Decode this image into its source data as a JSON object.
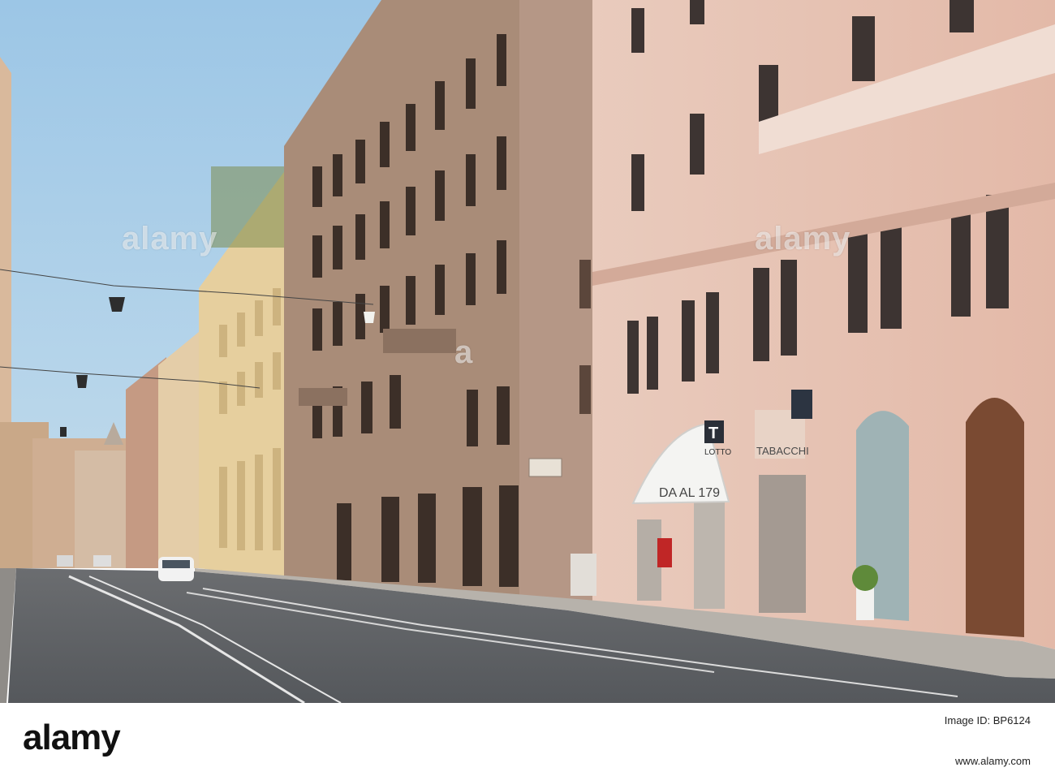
{
  "scene": {
    "description_kind": "street photograph",
    "colors": {
      "sky": "#a9cde8",
      "road": "#5f6266",
      "sidewalk": "#b7b2ab",
      "pink_building": "#e8c4b4",
      "brown_building": "#a98c78",
      "cream_building": "#e5cf9e",
      "awning": "#f4f4f2"
    },
    "signs": {
      "awning_text": "DA AL 179",
      "tabacchi_text": "TABACCHI",
      "lotto_text": "LOTTO",
      "tabacchi_T": "T"
    }
  },
  "watermark": {
    "left": "alamy",
    "center": "a",
    "right": "alamy"
  },
  "footer": {
    "logo": "alamy",
    "image_id": "Image ID: BP6124",
    "url": "www.alamy.com"
  }
}
